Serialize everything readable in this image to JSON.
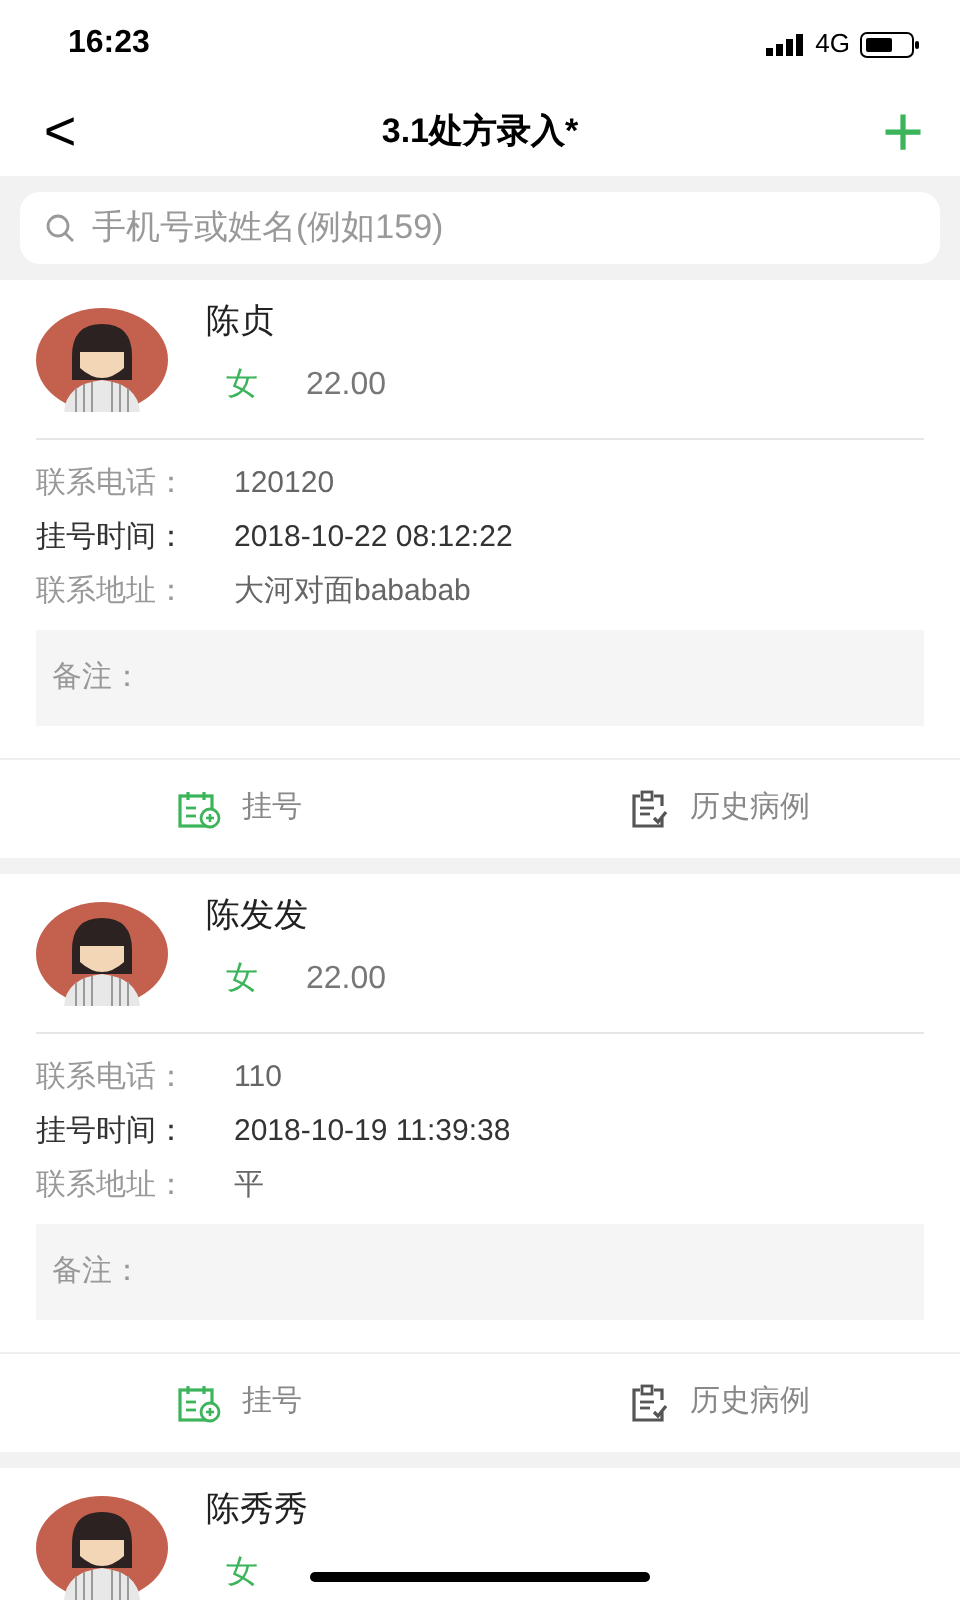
{
  "status_bar": {
    "time": "16:23",
    "network": "4G"
  },
  "nav": {
    "back": "<",
    "title": "3.1处方录入*",
    "add": "+"
  },
  "search": {
    "placeholder": "手机号或姓名(例如159)"
  },
  "patients": [
    {
      "name": "陈贞",
      "gender": "女",
      "age": "22.00",
      "rows": [
        {
          "label": "联系电话：",
          "value": "120120",
          "emphasized": false
        },
        {
          "label": "挂号时间：",
          "value": "2018-10-22 08:12:22",
          "emphasized": true
        },
        {
          "label": "联系地址：",
          "value": "大河对面bababab",
          "emphasized": false
        }
      ],
      "note_label": "备注：",
      "actions": [
        {
          "kind": "register",
          "label": "挂号"
        },
        {
          "kind": "history",
          "label": "历史病例"
        }
      ]
    },
    {
      "name": "陈发发",
      "gender": "女",
      "age": "22.00",
      "rows": [
        {
          "label": "联系电话：",
          "value": "110",
          "emphasized": false
        },
        {
          "label": "挂号时间：",
          "value": "2018-10-19 11:39:38",
          "emphasized": true
        },
        {
          "label": "联系地址：",
          "value": "平",
          "emphasized": false
        }
      ],
      "note_label": "备注：",
      "actions": [
        {
          "kind": "register",
          "label": "挂号"
        },
        {
          "kind": "history",
          "label": "历史病例"
        }
      ]
    },
    {
      "name": "陈秀秀",
      "gender": "女"
    }
  ]
}
